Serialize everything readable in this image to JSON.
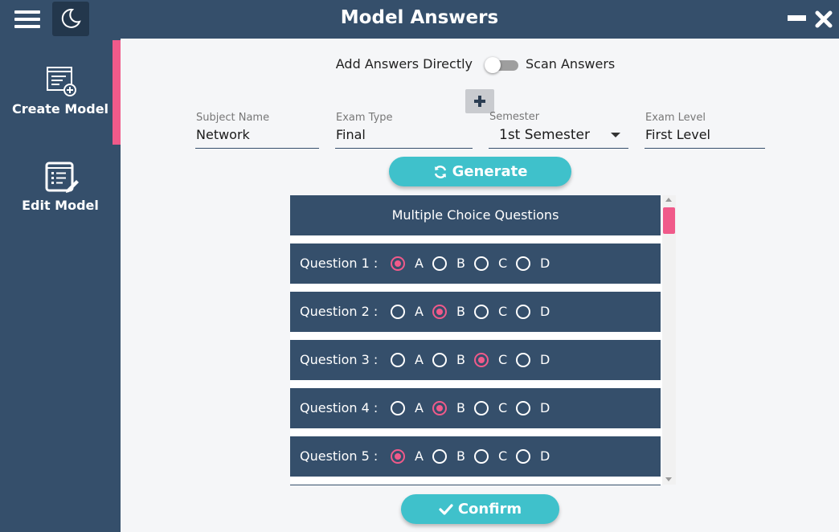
{
  "window": {
    "title": "Model Answers",
    "menu_icon": "hamburger-menu-icon",
    "theme_icon": "moon-icon",
    "minimize_icon": "minimize-icon",
    "close_icon": "close-icon"
  },
  "sidebar": {
    "items": [
      {
        "label": "Create Model",
        "icon": "create-document-icon",
        "active": true
      },
      {
        "label": "Edit Model",
        "icon": "edit-document-icon",
        "active": false
      }
    ]
  },
  "mode_toggle": {
    "left_label": "Add Answers Directly",
    "right_label": "Scan Answers",
    "on": false
  },
  "fields": {
    "subject": {
      "label": "Subject Name",
      "value": "Network"
    },
    "exam_type": {
      "label": "Exam Type",
      "value": "Final"
    },
    "semester": {
      "label": "Semester",
      "value": "1st Semester"
    },
    "exam_level": {
      "label": "Exam Level",
      "value": "First Level"
    }
  },
  "generate_label": "Generate",
  "confirm_label": "Confirm",
  "questions": {
    "header": "Multiple Choice Questions",
    "options": [
      "A",
      "B",
      "C",
      "D"
    ],
    "items": [
      {
        "label": "Question 1 :",
        "selected": "A"
      },
      {
        "label": "Question 2 :",
        "selected": "B"
      },
      {
        "label": "Question 3 :",
        "selected": "C"
      },
      {
        "label": "Question 4 :",
        "selected": "B"
      },
      {
        "label": "Question 5 :",
        "selected": "A"
      }
    ]
  },
  "colors": {
    "navy": "#354f6b",
    "accent_pink": "#f05a8a",
    "teal": "#3fc1cb",
    "background": "#f5f6f8"
  }
}
